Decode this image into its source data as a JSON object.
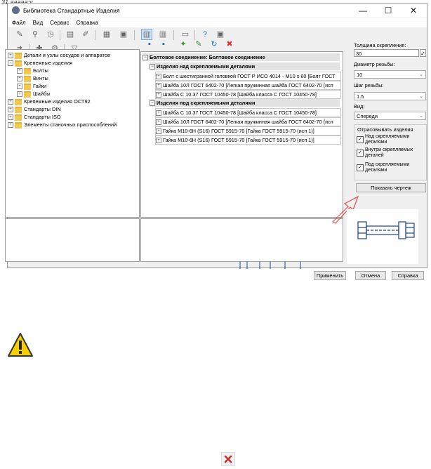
{
  "page_fragment": "31 aaaaa:y",
  "window": {
    "title": "Библиотека Стандартные Изделия",
    "minimize": "—",
    "maximize": "☐",
    "close": "✕"
  },
  "menu": [
    "Файл",
    "Вид",
    "Сервис",
    "Справка"
  ],
  "tree": {
    "items": [
      {
        "label": "Детали и узлы сосудов и аппаратов",
        "level": 0,
        "expanded": false
      },
      {
        "label": "Крепежные изделия",
        "level": 0,
        "expanded": true
      },
      {
        "label": "Болты",
        "level": 1,
        "expanded": false
      },
      {
        "label": "Винты",
        "level": 1,
        "expanded": false
      },
      {
        "label": "Гайки",
        "level": 1,
        "expanded": false
      },
      {
        "label": "Шайбы",
        "level": 1,
        "expanded": false
      },
      {
        "label": "Крепежные изделия ОСТ92",
        "level": 0,
        "expanded": false
      },
      {
        "label": "Стандарты DIN",
        "level": 0,
        "expanded": false
      },
      {
        "label": "Стандарты ISO",
        "level": 0,
        "expanded": false
      },
      {
        "label": "Элементы станочных приспособлений",
        "level": 0,
        "expanded": false
      }
    ]
  },
  "connection": {
    "title": "Болтовое соединение: Болтовое соединение",
    "groups": [
      {
        "title": "Изделия над скрепляемыми деталями",
        "items": [
          "Болт с шестигранной головкой ГОСТ Р ИСО 4014 - M10 x 60    [Болт ГОСТ",
          "Шайба 10Л ГОСТ 6402-70    [Легкая пружинная шайба ГОСТ 6402-70 (исп",
          "Шайба C 10.37 ГОСТ 10450-78    [Шайба класса С ГОСТ 10450-78]"
        ]
      },
      {
        "title": "Изделия под скрепляемыми деталями",
        "items": [
          "Шайба C 10.37 ГОСТ 10450-78    [Шайба класса С ГОСТ 10450-78]",
          "Шайба 10Л ГОСТ 6402-70    [Легкая пружинная шайба ГОСТ 6402-70 (исп",
          "Гайка М10-6Н (S16) ГОСТ 5915-70    [Гайка ГОСТ 5915-70 (исп 1)]",
          "Гайка М10-6Н (S16) ГОСТ 5915-70    [Гайка ГОСТ 5915-70 (исп 1)]"
        ]
      }
    ]
  },
  "params": {
    "thickness_label": "Толщина скрепления:",
    "thickness_value": "30",
    "diameter_label": "Диаметр резьбы:",
    "diameter_value": "10",
    "pitch_label": "Шаг резьбы:",
    "pitch_value": "1.5",
    "view_label": "Вид:",
    "view_value": "Спереди",
    "draw_group_label": "Отрисовывать изделия",
    "checkboxes": [
      {
        "label": "Над скрепляемыми деталями",
        "checked": true
      },
      {
        "label": "Внутри скрепляемых деталей",
        "checked": true
      },
      {
        "label": "Под скрепляемыми деталями",
        "checked": true
      }
    ],
    "show_drawing_button": "Показать чертеж"
  },
  "buttons": {
    "apply": "Применить",
    "cancel": "Отмена",
    "help": "Справка"
  },
  "colors": {
    "folder": "#f2c94c",
    "arrow": "#d9534f",
    "warning": "#f5d000",
    "bolt_preview": "#1a3fa0"
  }
}
